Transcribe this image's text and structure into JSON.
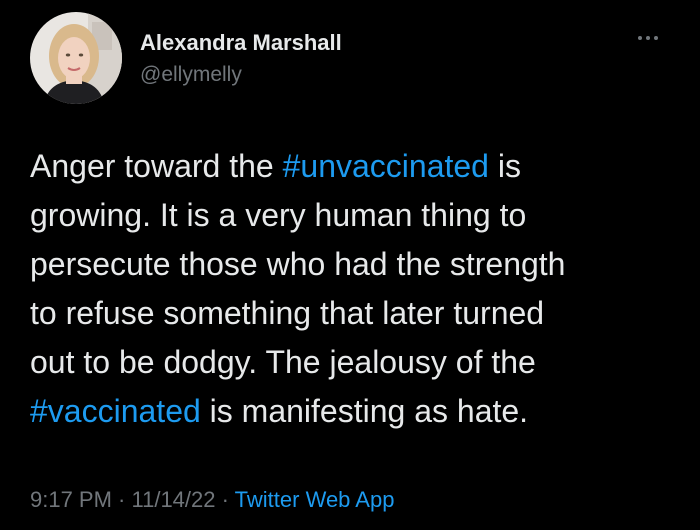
{
  "tweet": {
    "author": {
      "display_name": "Alexandra Marshall",
      "handle": "@ellymelly",
      "avatar": "profile-photo"
    },
    "menu_icon": "more-horizontal-icon",
    "text_lines": [
      [
        {
          "t": "Anger toward the "
        },
        {
          "t": "#unvaccinated",
          "tag": true
        },
        {
          "t": " is"
        }
      ],
      [
        {
          "t": "growing. It is a very human thing to"
        }
      ],
      [
        {
          "t": "persecute those who had the strength"
        }
      ],
      [
        {
          "t": "to refuse something that later turned"
        }
      ],
      [
        {
          "t": "out to be dodgy. The jealousy of the"
        }
      ],
      [
        {
          "t": "#vaccinated",
          "tag": true
        },
        {
          "t": " is manifesting as hate."
        }
      ]
    ],
    "time": "9:17 PM",
    "separator": " · ",
    "date": "11/14/22",
    "source": "Twitter Web App"
  },
  "colors": {
    "background": "#000000",
    "text": "#e7e9ea",
    "secondary": "#71767b",
    "link": "#1d9bf0"
  }
}
